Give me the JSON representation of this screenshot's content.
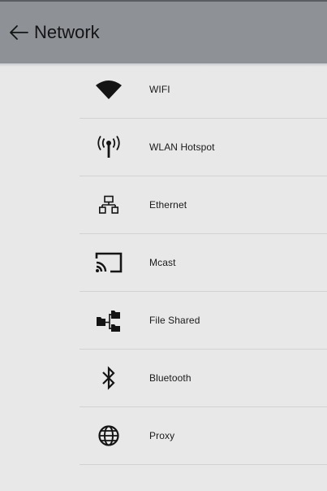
{
  "header": {
    "title": "Network",
    "back_icon": "arrow-left-icon"
  },
  "items": [
    {
      "label": "WIFI",
      "icon": "wifi-icon"
    },
    {
      "label": "WLAN Hotspot",
      "icon": "hotspot-icon"
    },
    {
      "label": "Ethernet",
      "icon": "ethernet-icon"
    },
    {
      "label": "Mcast",
      "icon": "cast-icon"
    },
    {
      "label": "File Shared",
      "icon": "file-shared-icon"
    },
    {
      "label": "Bluetooth",
      "icon": "bluetooth-icon"
    },
    {
      "label": "Proxy",
      "icon": "globe-icon"
    }
  ],
  "colors": {
    "header_bg": "#8e9196",
    "page_bg": "#e8e8e8",
    "divider": "#d2d2d2",
    "icon": "#141414"
  }
}
